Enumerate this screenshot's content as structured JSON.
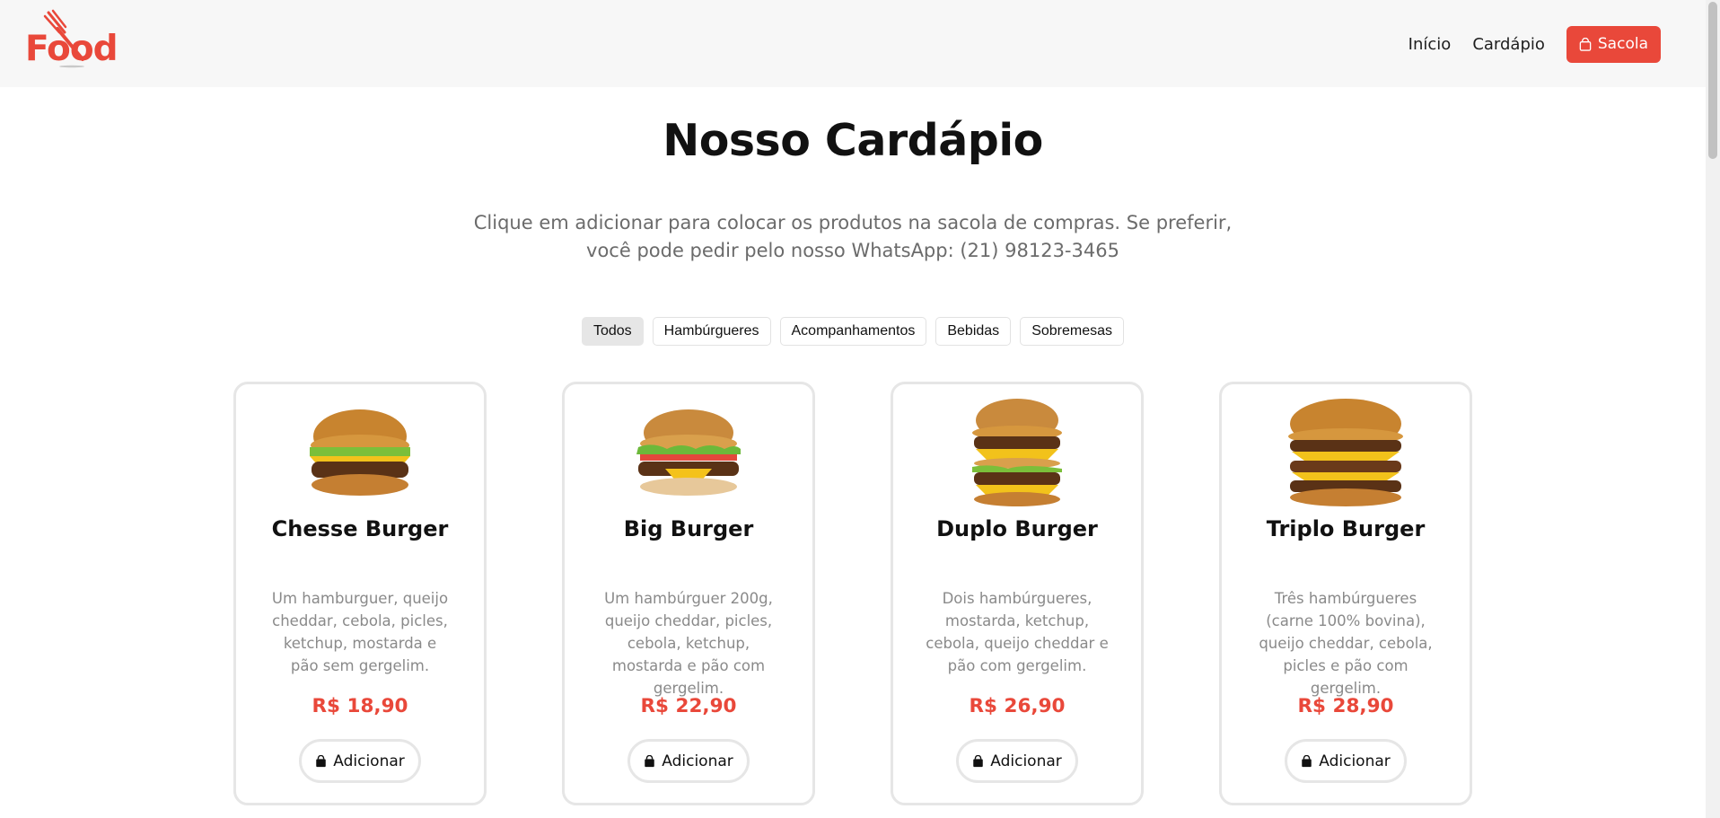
{
  "header": {
    "logo_text": "Food",
    "nav": [
      {
        "label": "Início"
      },
      {
        "label": "Cardápio"
      }
    ],
    "bag_label": "Sacola"
  },
  "main": {
    "title": "Nosso Cardápio",
    "subtitle": "Clique em adicionar para colocar os produtos na sacola de compras. Se preferir, você pode pedir pelo nosso WhatsApp: (21) 98123-3465",
    "filters": [
      {
        "label": "Todos",
        "active": true
      },
      {
        "label": "Hambúrgueres",
        "active": false
      },
      {
        "label": "Acompanhamentos",
        "active": false
      },
      {
        "label": "Bebidas",
        "active": false
      },
      {
        "label": "Sobremesas",
        "active": false
      }
    ],
    "products": [
      {
        "name": "Chesse Burger",
        "description": "Um hamburguer, queijo cheddar, cebola, picles, ketchup, mostarda e pão sem gergelim.",
        "price": "R$ 18,90",
        "add_label": "Adicionar",
        "icon": "cheeseburger-image"
      },
      {
        "name": "Big Burger",
        "description": "Um hambúrguer 200g, queijo cheddar, picles, cebola, ketchup, mostarda e pão com gergelim.",
        "price": "R$ 22,90",
        "add_label": "Adicionar",
        "icon": "big-burger-image"
      },
      {
        "name": "Duplo Burger",
        "description": "Dois hambúrgueres, mostarda, ketchup, cebola, queijo cheddar e pão com gergelim.",
        "price": "R$ 26,90",
        "add_label": "Adicionar",
        "icon": "double-burger-image"
      },
      {
        "name": "Triplo Burger",
        "description": "Três hambúrgueres (carne 100% bovina), queijo cheddar, cebola, picles e pão com gergelim.",
        "price": "R$ 28,90",
        "add_label": "Adicionar",
        "icon": "triple-burger-image"
      }
    ]
  },
  "colors": {
    "accent": "#e9483a",
    "header_bg": "#f7f7f7",
    "card_border": "#e6e6e6",
    "muted_text": "#8a8a8a"
  }
}
